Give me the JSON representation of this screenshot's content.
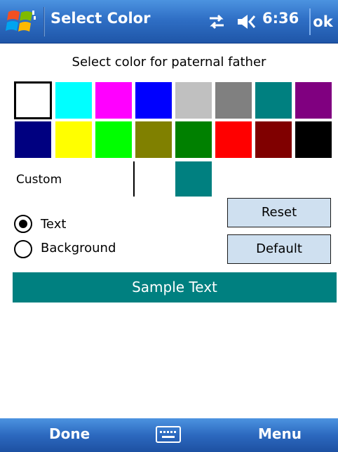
{
  "title_bar": {
    "title": "Select Color",
    "time": "6:36",
    "ok_label": "ok",
    "icons": [
      "windows-start-icon",
      "connectivity-icon",
      "volume-icon"
    ]
  },
  "prompt": "Select color for paternal father",
  "palette": {
    "row1": [
      "#ffffff",
      "#00ffff",
      "#ff00ff",
      "#0000ff",
      "#c0c0c0",
      "#808080",
      "#008080",
      "#800080"
    ],
    "row2": [
      "#000080",
      "#ffff00",
      "#00ff00",
      "#808000",
      "#008000",
      "#ff0000",
      "#800000",
      "#000000"
    ],
    "selected": "#ffffff"
  },
  "custom": {
    "label": "Custom",
    "color": "#008080"
  },
  "options": {
    "text_label": "Text",
    "background_label": "Background",
    "selected": "Text"
  },
  "buttons": {
    "reset": "Reset",
    "default": "Default"
  },
  "sample": {
    "label": "Sample Text",
    "background": "#008080",
    "text_color": "#ffffff"
  },
  "softkeys": {
    "left": "Done",
    "right": "Menu",
    "center_icon": "keyboard-icon"
  }
}
